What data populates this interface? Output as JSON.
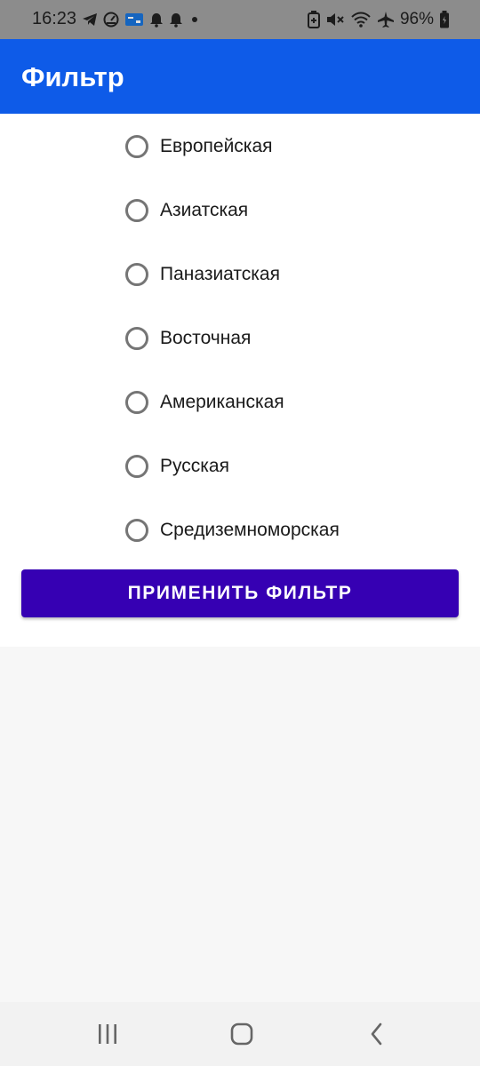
{
  "status_bar": {
    "time": "16:23",
    "battery": "96%",
    "left_icons": [
      "telegram-icon",
      "speedometer-icon",
      "card-icon",
      "bell-icon",
      "bell-icon",
      "dot-icon"
    ],
    "right_icons": [
      "battery-saver-icon",
      "mute-icon",
      "wifi-icon",
      "airplane-icon",
      "battery-icon"
    ]
  },
  "app_bar": {
    "title": "Фильтр",
    "color": "#0e5be8"
  },
  "filter": {
    "options": [
      {
        "label": "Европейская",
        "selected": false
      },
      {
        "label": "Азиатская",
        "selected": false
      },
      {
        "label": "Паназиатская",
        "selected": false
      },
      {
        "label": "Восточная",
        "selected": false
      },
      {
        "label": "Американская",
        "selected": false
      },
      {
        "label": "Русская",
        "selected": false
      },
      {
        "label": "Средиземноморская",
        "selected": false
      }
    ],
    "apply_label": "ПРИМЕНИТЬ ФИЛЬТР",
    "apply_color": "#3600b3"
  },
  "nav_bar": {
    "buttons": [
      "recents-icon",
      "home-icon",
      "back-icon"
    ]
  }
}
